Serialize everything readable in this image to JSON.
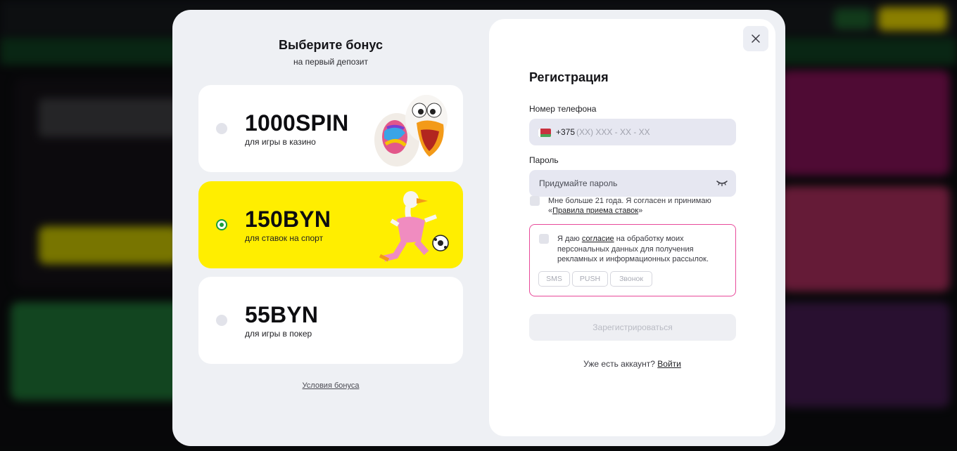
{
  "bonus": {
    "title": "Выберите бонус",
    "subtitle": "на первый депозит",
    "options": [
      {
        "amount": "1000SPIN",
        "desc": "для игры в казино",
        "selected": false
      },
      {
        "amount": "150BYN",
        "desc": "для ставок на спорт",
        "selected": true
      },
      {
        "amount": "55BYN",
        "desc": "для игры в покер",
        "selected": false
      }
    ],
    "terms_link": "Условия бонуса"
  },
  "registration": {
    "title": "Регистрация",
    "phone_label": "Номер телефона",
    "phone_prefix": "+375",
    "phone_placeholder": "(XX) XXX - XX - XX",
    "password_label": "Пароль",
    "password_placeholder": "Придумайте пароль",
    "age_text": "Мне больше 21 года. Я согласен и принимаю «",
    "age_link": "Правила приема ставок",
    "age_close": "»",
    "consent_pre": "Я даю ",
    "consent_link": "согласие",
    "consent_post": " на обработку моих персональных данных для получения рекламных и информационных рассылок.",
    "channels": [
      "SMS",
      "PUSH",
      "Звонок"
    ],
    "submit_label": "Зарегистрироваться",
    "login_prompt": "Уже есть аккаунт? ",
    "login_link": "Войти"
  },
  "icons": {
    "close": "close-icon",
    "eye": "eye-closed-icon",
    "flag": "belarus-flag-icon"
  },
  "colors": {
    "selected_card": "#ffee00",
    "radio_selected": "#1a9e3a",
    "consent_border": "#e84a9a"
  }
}
